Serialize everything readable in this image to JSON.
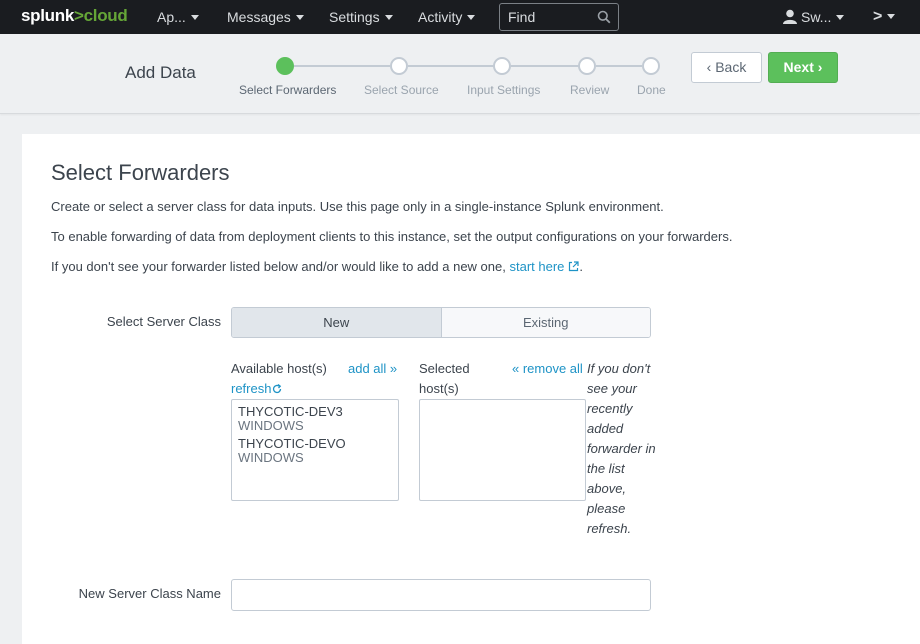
{
  "topbar": {
    "logo_main": "splunk",
    "logo_accent": ">cloud",
    "apps_label": "Ap...",
    "messages_label": "Messages",
    "settings_label": "Settings",
    "activity_label": "Activity",
    "find_placeholder": "Find",
    "user_label": "Sw...",
    "more_label": ">"
  },
  "wizard": {
    "title": "Add Data",
    "steps": [
      {
        "label": "Select Forwarders",
        "active": true
      },
      {
        "label": "Select Source",
        "active": false
      },
      {
        "label": "Input Settings",
        "active": false
      },
      {
        "label": "Review",
        "active": false
      },
      {
        "label": "Done",
        "active": false
      }
    ],
    "back_label": "Back",
    "next_label": "Next",
    "accent_color": "#5cc05c"
  },
  "page": {
    "title": "Select Forwarders",
    "line1": "Create or select a server class for data inputs. Use this page only in a single-instance Splunk environment.",
    "line2": "To enable forwarding of data from deployment clients to this instance, set the output configurations on your forwarders.",
    "line3_prefix": "If you don't see your forwarder listed below and/or would like to add a new one, ",
    "line3_link": "start here",
    "line3_suffix": "."
  },
  "form": {
    "server_class_label": "Select Server Class",
    "server_class_options": [
      "New",
      "Existing"
    ],
    "server_class_selected": "New",
    "available_hosts_label": "Available host(s)",
    "add_all_label": "add all »",
    "refresh_label": "refresh",
    "available_hosts": [
      {
        "name": "THYCOTIC-DEV3",
        "os": "WINDOWS"
      },
      {
        "name": "THYCOTIC-DEVO",
        "os": "WINDOWS"
      }
    ],
    "selected_hosts_label_1": "Selected",
    "selected_hosts_label_2": "host(s)",
    "remove_all_label": "« remove all",
    "hint": "If you don't see your recently added forwarder in the list above, please refresh.",
    "new_server_class_label": "New Server Class Name",
    "new_server_class_value": ""
  }
}
